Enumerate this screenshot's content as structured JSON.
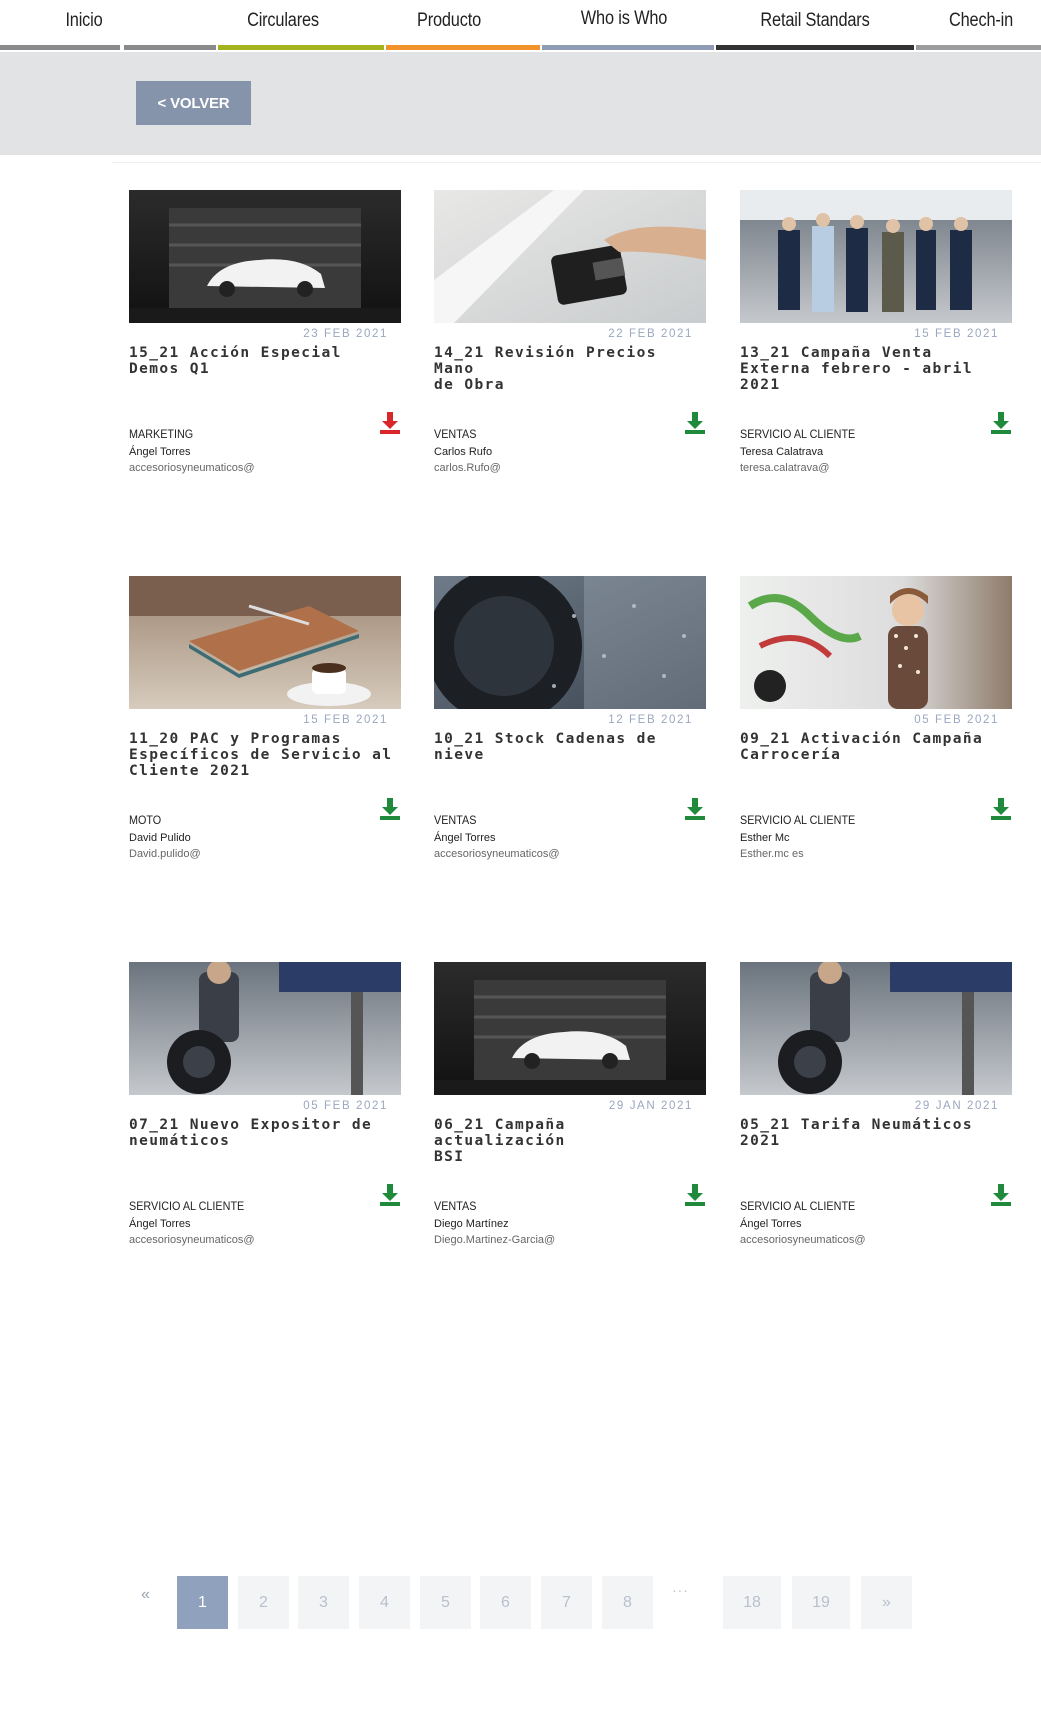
{
  "nav": {
    "items": [
      {
        "label": "Inicio",
        "color": "#8a8a8a"
      },
      {
        "label": "Circulares",
        "color": "#a3b41f"
      },
      {
        "label": "Producto",
        "color": "#f2922a"
      },
      {
        "label": "Who is Who",
        "color": "#8e9cb6"
      },
      {
        "label": "Retail Standars",
        "color": "#333333"
      },
      {
        "label": "Chech-in",
        "color": "#9c9c9c"
      }
    ]
  },
  "toolbar": {
    "back_label": "< VOLVER"
  },
  "cards": [
    {
      "date": "23 FEB 2021",
      "title": "15_21 Acción Especial\nDemos Q1",
      "category": "MARKETING",
      "author": "Ángel Torres",
      "email": "accesoriosyneumaticos@",
      "icon": "download-icon",
      "icon_color": "#d9262b"
    },
    {
      "date": "22 FEB 2021",
      "title": "14_21 Revisión Precios Mano\nde Obra",
      "category": "VENTAS",
      "author": "Carlos Rufo",
      "email": "carlos.Rufo@",
      "icon": "download-icon",
      "icon_color": "#1f8a3b"
    },
    {
      "date": "15 FEB 2021",
      "title": "13_21 Campaña Venta\nExterna febrero - abril 2021",
      "category": "SERVICIO AL CLIENTE",
      "author": "Teresa Calatrava",
      "email": "teresa.calatrava@",
      "icon": "download-icon",
      "icon_color": "#1f8a3b"
    },
    {
      "date": "15 FEB 2021",
      "title": "11_20 PAC y Programas\nEspecíficos de Servicio al\nCliente 2021",
      "category": "MOTO",
      "author": "David Pulido",
      "email": "David.pulido@",
      "icon": "download-icon",
      "icon_color": "#1f8a3b"
    },
    {
      "date": "12 FEB 2021",
      "title": "10_21 Stock Cadenas de\nnieve",
      "category": "VENTAS",
      "author": "Ángel Torres",
      "email": "accesoriosyneumaticos@",
      "icon": "download-icon",
      "icon_color": "#1f8a3b"
    },
    {
      "date": "05 FEB 2021",
      "title": "09_21 Activación Campaña\nCarrocería",
      "category": "SERVICIO AL CLIENTE",
      "author": "Esther Mc",
      "email": "Esther.mc                    es",
      "icon": "download-icon",
      "icon_color": "#1f8a3b"
    },
    {
      "date": "05 FEB 2021",
      "title": "07_21 Nuevo Expositor de\nneumáticos",
      "category": "SERVICIO AL CLIENTE",
      "author": "Ángel Torres",
      "email": "accesoriosyneumaticos@",
      "icon": "download-icon",
      "icon_color": "#1f8a3b"
    },
    {
      "date": "29 JAN 2021",
      "title": "06_21 Campaña actualización\nBSI",
      "category": "VENTAS",
      "author": "Diego Martínez",
      "email": "Diego.Martinez-Garcia@",
      "icon": "download-icon",
      "icon_color": "#1f8a3b"
    },
    {
      "date": "29 JAN 2021",
      "title": "05_21 Tarifa Neumáticos\n2021",
      "category": "SERVICIO AL CLIENTE",
      "author": "Ángel Torres",
      "email": "accesoriosyneumaticos@",
      "icon": "download-icon",
      "icon_color": "#1f8a3b"
    }
  ],
  "pagination": {
    "prev": "«",
    "pages": [
      "1",
      "2",
      "3",
      "4",
      "5",
      "6",
      "7",
      "8",
      "18",
      "19"
    ],
    "ellipsis": "···",
    "next": "»",
    "current": "1"
  }
}
